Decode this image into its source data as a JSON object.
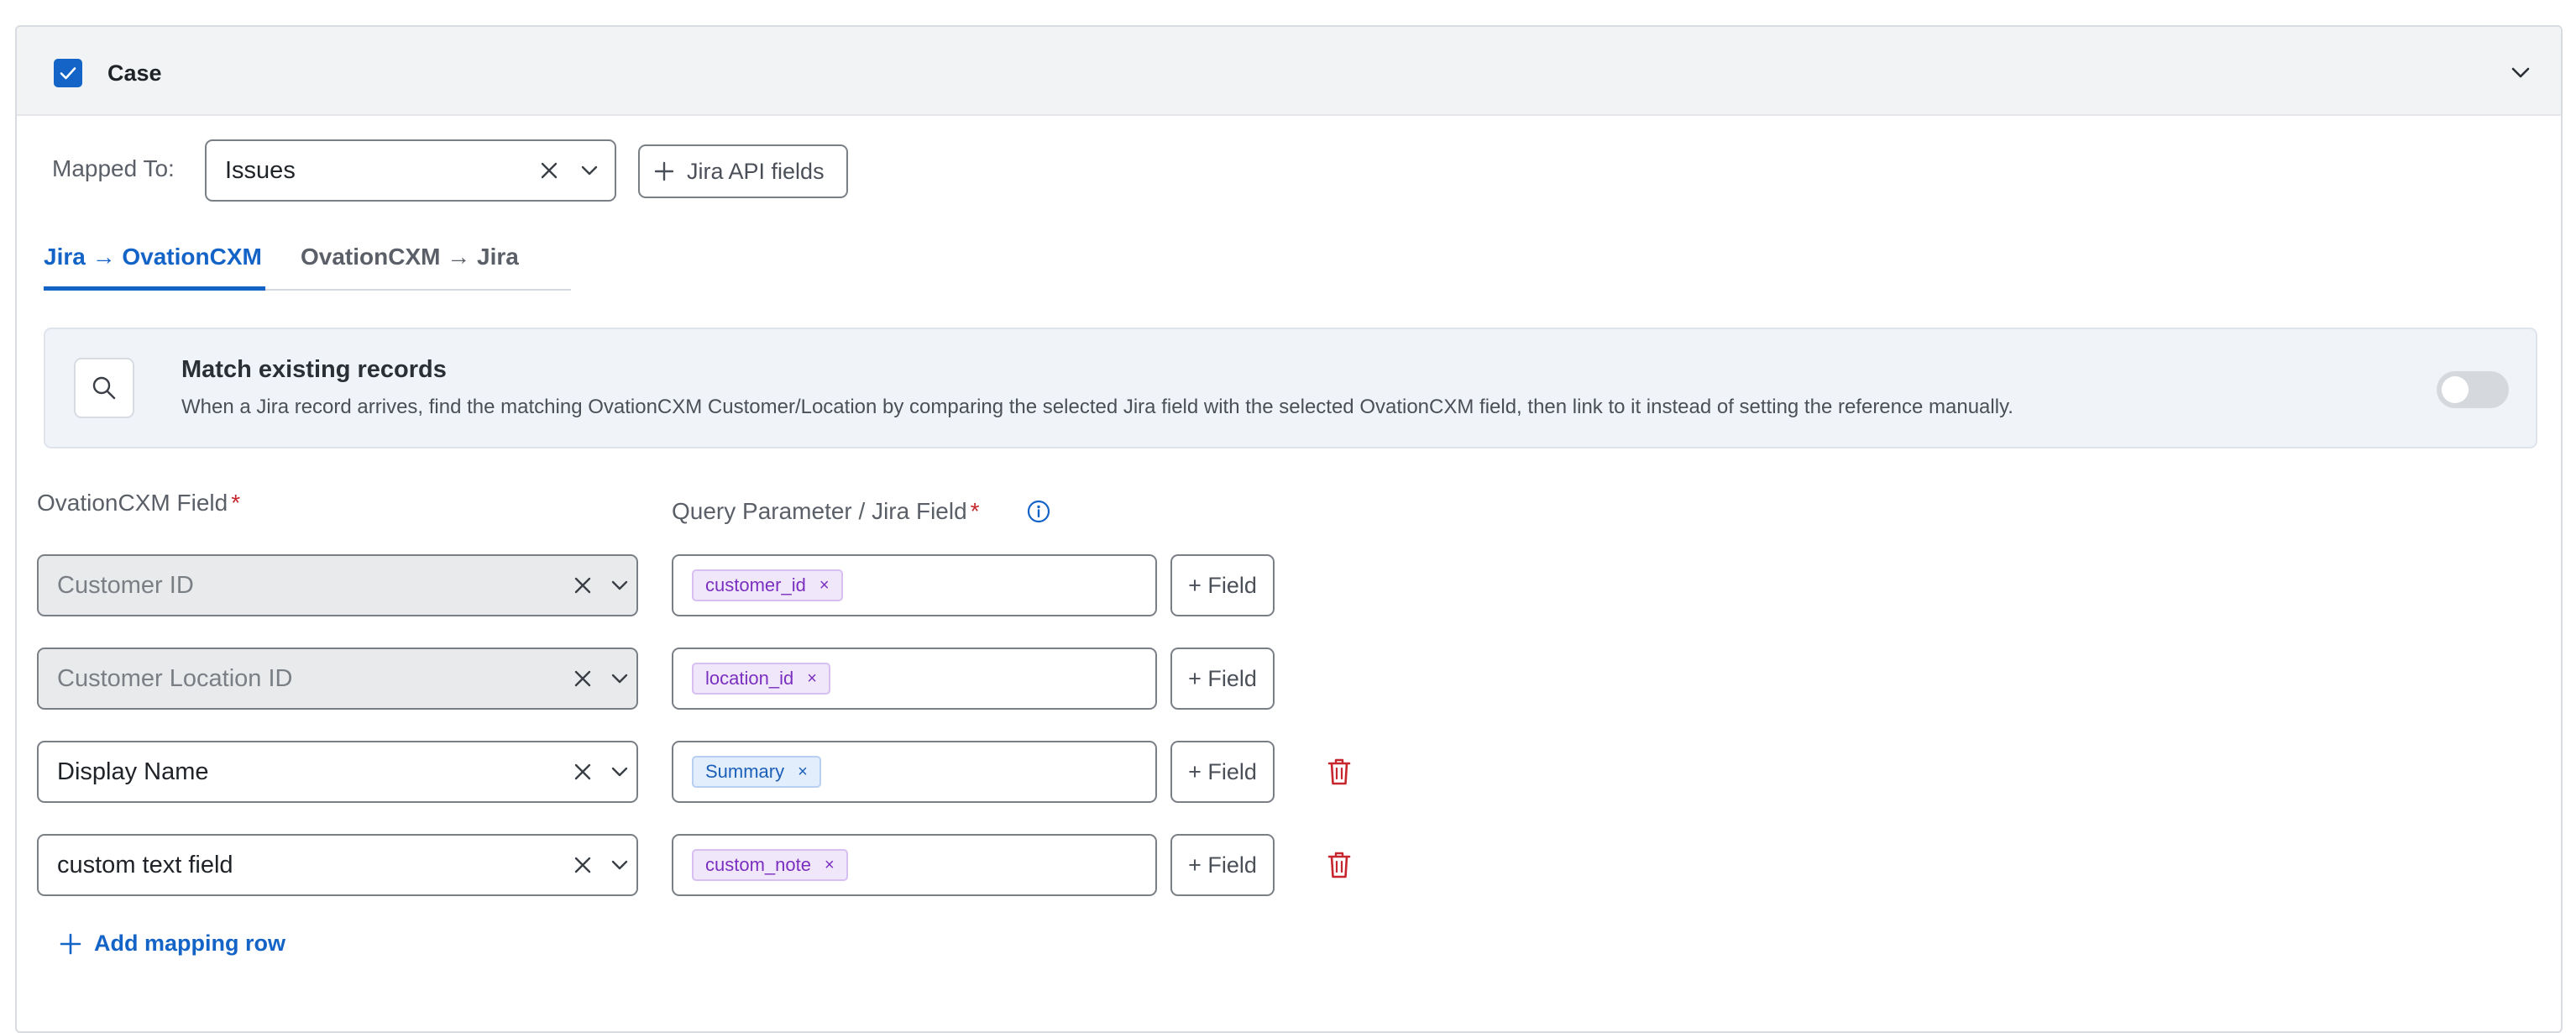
{
  "section": {
    "title": "Case",
    "checked": true
  },
  "mapping": {
    "label": "Mapped To:",
    "selected": "Issues",
    "api_button_label": "Jira API fields"
  },
  "tabs": [
    {
      "label": "Jira → OvationCXM",
      "active": true
    },
    {
      "label": "OvationCXM → Jira",
      "active": false
    }
  ],
  "match": {
    "title": "Match existing records",
    "description": "When a Jira record arrives, find the matching OvationCXM Customer/Location by comparing the selected Jira field with the selected OvationCXM field, then link to it instead of setting the reference manually.",
    "enabled": false
  },
  "columns": {
    "ovation_field": "OvationCXM Field",
    "query_field": "Query Parameter / Jira Field",
    "required_marker": "*"
  },
  "rows": [
    {
      "field": "Customer ID",
      "disabled": true,
      "chip": "customer_id",
      "chip_color": "purple",
      "field_button": "+ Field",
      "deletable": false
    },
    {
      "field": "Customer Location ID",
      "disabled": true,
      "chip": "location_id",
      "chip_color": "purple",
      "field_button": "+ Field",
      "deletable": false
    },
    {
      "field": "Display Name",
      "disabled": false,
      "chip": "Summary",
      "chip_color": "blue",
      "field_button": "+ Field",
      "deletable": true
    },
    {
      "field": "custom text field",
      "disabled": false,
      "chip": "custom_note",
      "chip_color": "purple",
      "field_button": "+ Field",
      "deletable": true
    }
  ],
  "add_row_label": "Add mapping row",
  "chip_remove_glyph": "×",
  "colors": {
    "accent": "#1464c7",
    "danger": "#c8262e",
    "chip_purple_text": "#7a2fbf",
    "chip_blue_text": "#1c5fb8"
  }
}
